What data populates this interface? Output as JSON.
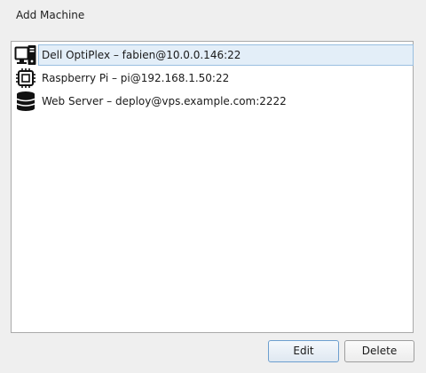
{
  "window": {
    "title": "Add Machine"
  },
  "machines": [
    {
      "icon": "desktop-computer-icon",
      "label": "Dell OptiPlex  –  fabien@10.0.0.146:22",
      "selected": true
    },
    {
      "icon": "chip-icon",
      "label": "Raspberry Pi  –  pi@192.168.1.50:22",
      "selected": false
    },
    {
      "icon": "database-server-icon",
      "label": "Web Server  –  deploy@vps.example.com:2222",
      "selected": false
    }
  ],
  "buttons": {
    "edit_label": "Edit",
    "delete_label": "Delete"
  },
  "colors": {
    "selection_fill": "#e3eef8",
    "selection_border": "#99bfe0",
    "default_button_border": "#6d9fcf"
  }
}
